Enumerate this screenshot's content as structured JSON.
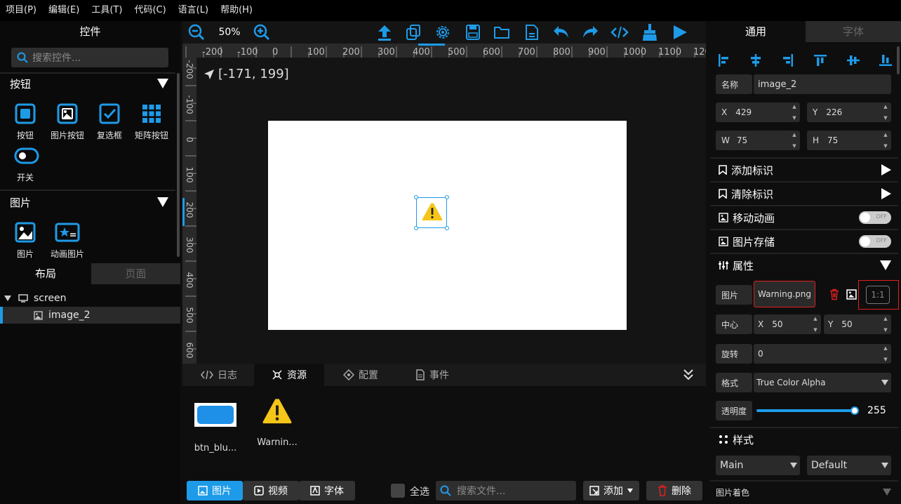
{
  "menubar": {
    "items": [
      "项目(P)",
      "编辑(E)",
      "工具(T)",
      "代码(C)",
      "语言(L)",
      "帮助(H)"
    ]
  },
  "left": {
    "title": "控件",
    "search_placeholder": "搜索控件...",
    "section_buttons": "按钮",
    "widgets_buttons": [
      {
        "label": "按钮",
        "icon": "button-icon"
      },
      {
        "label": "图片按钮",
        "icon": "image-button-icon"
      },
      {
        "label": "复选框",
        "icon": "checkbox-icon"
      },
      {
        "label": "矩阵按钮",
        "icon": "button-matrix-icon"
      },
      {
        "label": "开关",
        "icon": "switch-icon"
      }
    ],
    "section_images": "图片",
    "widgets_images": [
      {
        "label": "图片",
        "icon": "image-icon"
      },
      {
        "label": "动画图片",
        "icon": "animated-image-icon"
      }
    ],
    "tabs": {
      "layout": "布局",
      "page": "页面"
    },
    "tree": {
      "root": "screen",
      "child": "image_2"
    }
  },
  "toolbar": {
    "zoom": "50%"
  },
  "canvas": {
    "coords": "[-171, 199]",
    "ruler_top": [
      "-200",
      "-100",
      "0",
      "100",
      "200",
      "300",
      "400",
      "500",
      "600",
      "700",
      "800",
      "900",
      "1000",
      "1100",
      "120"
    ],
    "ruler_left": [
      "-200",
      "-100",
      "0",
      "100",
      "200",
      "300",
      "400",
      "500",
      "600"
    ]
  },
  "bottom": {
    "tabs": {
      "log": "日志",
      "resources": "资源",
      "config": "配置",
      "events": "事件"
    },
    "assets": [
      {
        "label": "btn_blu...",
        "icon": "blue-button-thumbnail"
      },
      {
        "label": "Warnin...",
        "icon": "warning-icon"
      }
    ],
    "filter_tabs": {
      "images": "图片",
      "video": "视频",
      "font": "字体"
    },
    "select_all": "全选",
    "search_placeholder": "搜索文件...",
    "add": "添加",
    "delete": "删除"
  },
  "right": {
    "tabs": {
      "general": "通用",
      "font": "字体"
    },
    "name_label": "名称",
    "name_value": "image_2",
    "x_label": "X",
    "x_value": "429",
    "y_label": "Y",
    "y_value": "226",
    "w_label": "W",
    "w_value": "75",
    "h_label": "H",
    "h_value": "75",
    "add_flag": "添加标识",
    "clear_flag": "清除标识",
    "move_anim": "移动动画",
    "image_store": "图片存储",
    "toggle_off": "OFF",
    "properties": "属性",
    "image_label": "图片",
    "image_value": "Warning.png",
    "ratio": "1:1",
    "center_label": "中心",
    "cx_label": "X",
    "cx_value": "50",
    "cy_label": "Y",
    "cy_value": "50",
    "rotate_label": "旋转",
    "rotate_value": "0",
    "format_label": "格式",
    "format_value": "True Color Alpha",
    "opacity_label": "透明度",
    "opacity_value": "255",
    "opacity_fraction": 1.0,
    "style_label": "样式",
    "style_part": "Main",
    "style_state": "Default",
    "tint_label": "图片着色"
  },
  "colors": {
    "accent": "#1e9be8",
    "warning": "#f5c518",
    "highlight": "#e02020"
  }
}
